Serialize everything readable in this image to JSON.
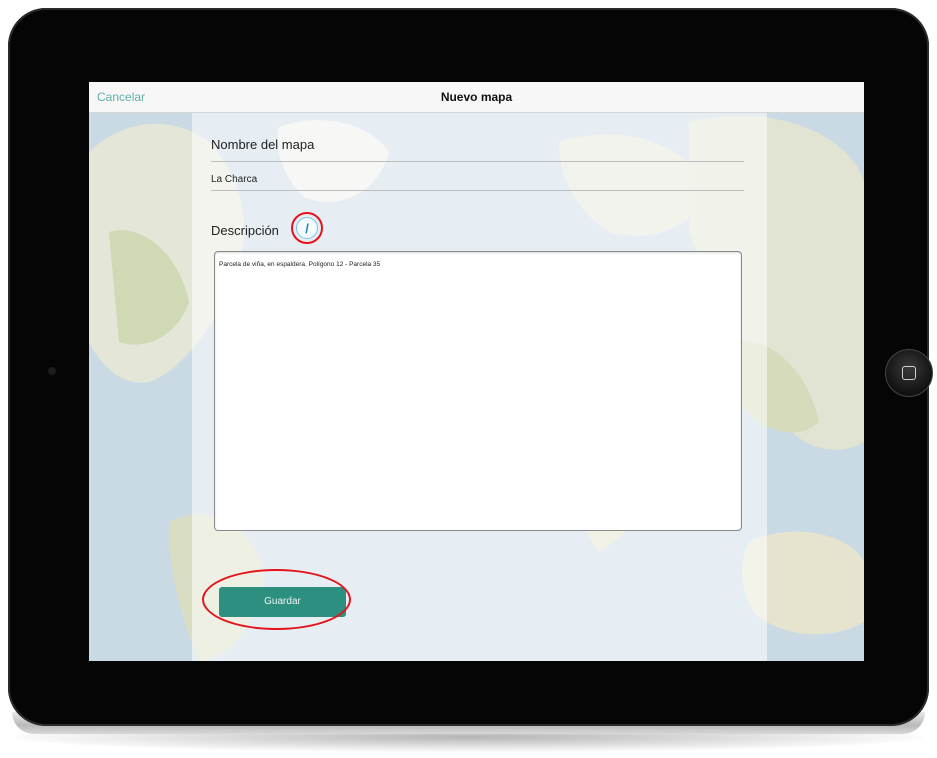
{
  "nav": {
    "cancel_label": "Cancelar",
    "title": "Nuevo mapa"
  },
  "form": {
    "name_label": "Nombre del mapa",
    "name_value": "La Charca",
    "description_label": "Descripción",
    "description_value": "Parcela de viña, en espaldera. Polígono 12 - Parcela 35",
    "save_label": "Guardar"
  },
  "icons": {
    "edit": "pencil-icon",
    "home": "home-button-icon"
  },
  "colors": {
    "accent_teal": "#2d8f80",
    "cancel_text": "#5fb0a6",
    "highlight_red": "#e3141b"
  }
}
